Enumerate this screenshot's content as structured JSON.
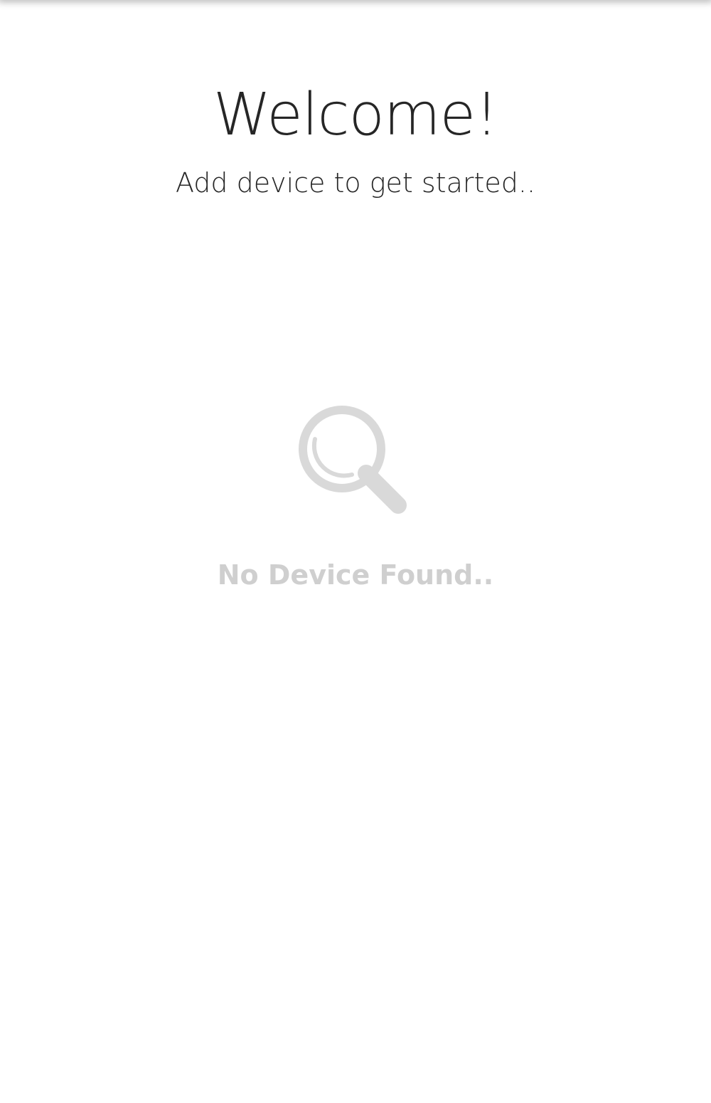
{
  "header": {
    "title": "Welcome!",
    "subtitle": "Add device to get started.."
  },
  "empty_state": {
    "icon": "search-icon",
    "message": "No Device Found.."
  },
  "colors": {
    "title_text": "#262626",
    "empty_state": "#d9d9d9"
  }
}
